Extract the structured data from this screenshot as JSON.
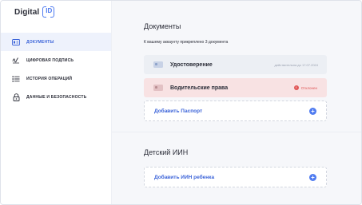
{
  "logo": {
    "text": "Digital",
    "id_text": "ID"
  },
  "sidebar": {
    "items": [
      {
        "label": "ДОКУМЕНТЫ",
        "icon": "id-card-icon",
        "active": true
      },
      {
        "label": "ЦИФРОВАЯ ПОДПИСЬ",
        "icon": "signature-icon",
        "active": false
      },
      {
        "label": "ИСТОРИЯ ОПЕРАЦИЙ",
        "icon": "list-icon",
        "active": false
      },
      {
        "label": "ДАННЫЕ И БЕЗОПАСНОСТЬ",
        "icon": "lock-icon",
        "active": false
      }
    ]
  },
  "main": {
    "documents_title": "Документы",
    "documents_subtitle": "К вашему аккаунту прикреплено 3 документа",
    "documents": [
      {
        "title": "Удостоверение",
        "meta": "действительна до 17.07.2024"
      },
      {
        "title": "Водительские права",
        "status": "Отклонен",
        "status_icon": "!"
      }
    ],
    "add_passport": {
      "label": "Добавить Паспорт",
      "plus": "+"
    },
    "child_title": "Детский ИИН",
    "add_child": {
      "label": "Добавить ИИН ребенка",
      "plus": "+"
    }
  },
  "colors": {
    "accent": "#4f7bf0",
    "active_bg": "#eef2fc",
    "error": "#e05656",
    "error_bg": "#f8e2e3",
    "main_bg": "#f6f7fa"
  }
}
